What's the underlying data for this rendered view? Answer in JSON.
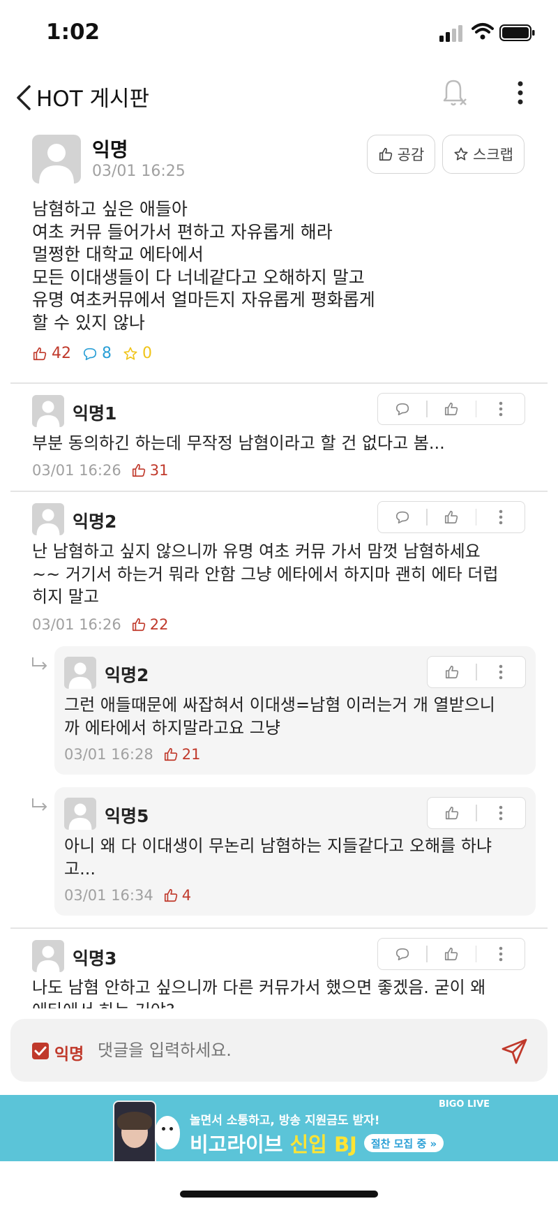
{
  "status_bar": {
    "time": "1:02"
  },
  "header": {
    "title": "HOT 게시판"
  },
  "post": {
    "author": "익명",
    "date": "03/01 16:25",
    "like_button_label": "공감",
    "scrap_button_label": "스크랩",
    "body_lines": [
      "남혐하고 싶은 애들아",
      "여초 커뮤 들어가서 편하고 자유롭게 해라",
      "멀쩡한 대학교 에타에서",
      "모든 이대생들이 다 너네같다고 오해하지 말고",
      "유명 여초커뮤에서 얼마든지 자유롭게 평화롭게",
      "할 수 있지 않나"
    ],
    "likes": "42",
    "comments": "8",
    "scraps": "0"
  },
  "comments": [
    {
      "author": "익명1",
      "lines": [
        "부분 동의하긴 하는데 무작정 남혐이라고 할 건 없다고 봄..."
      ],
      "date": "03/01 16:26",
      "likes": "31"
    },
    {
      "author": "익명2",
      "lines": [
        "난 남혐하고 싶지 않으니까 유명 여초 커뮤 가서 맘껏 남혐하세요",
        "~~ 거기서 하는거 뭐라 안함 그냥 에타에서 하지마 괜히 에타 더럽",
        "히지 말고"
      ],
      "date": "03/01 16:26",
      "likes": "22"
    },
    {
      "author": "익명2",
      "lines": [
        "그런 애들때문에 싸잡혀서 이대생=남혐 이러는거 개 열받으니",
        "까 에타에서 하지말라고요 그냥"
      ],
      "date": "03/01 16:28",
      "likes": "21"
    },
    {
      "author": "익명5",
      "lines": [
        "아니 왜 다 이대생이 무논리 남혐하는 지들같다고 오해를 하냐",
        "고..."
      ],
      "date": "03/01 16:34",
      "likes": "4"
    },
    {
      "author": "익명3",
      "lines": [
        "나도 남혐 안하고 싶으니까 다른 커뮤가서 했으면 좋겠음. 굳이 왜",
        "에타에서 하는 거야?"
      ]
    }
  ],
  "comment_input": {
    "anonymous_label": "익명",
    "placeholder": "댓글을 입력하세요."
  },
  "ad": {
    "brand": "BIGO LIVE",
    "headline": "놀면서 소통하고, 방송 지원금도 받자!",
    "title_white": "비고라이브 ",
    "title_yellow": "신입 BJ",
    "cta": "절찬 모집 중 »"
  },
  "colors": {
    "accent_red": "#c0392b",
    "comment_blue": "#2a9fd6",
    "scrap_yellow": "#f0c419",
    "ad_bg": "#5bc4d8"
  }
}
